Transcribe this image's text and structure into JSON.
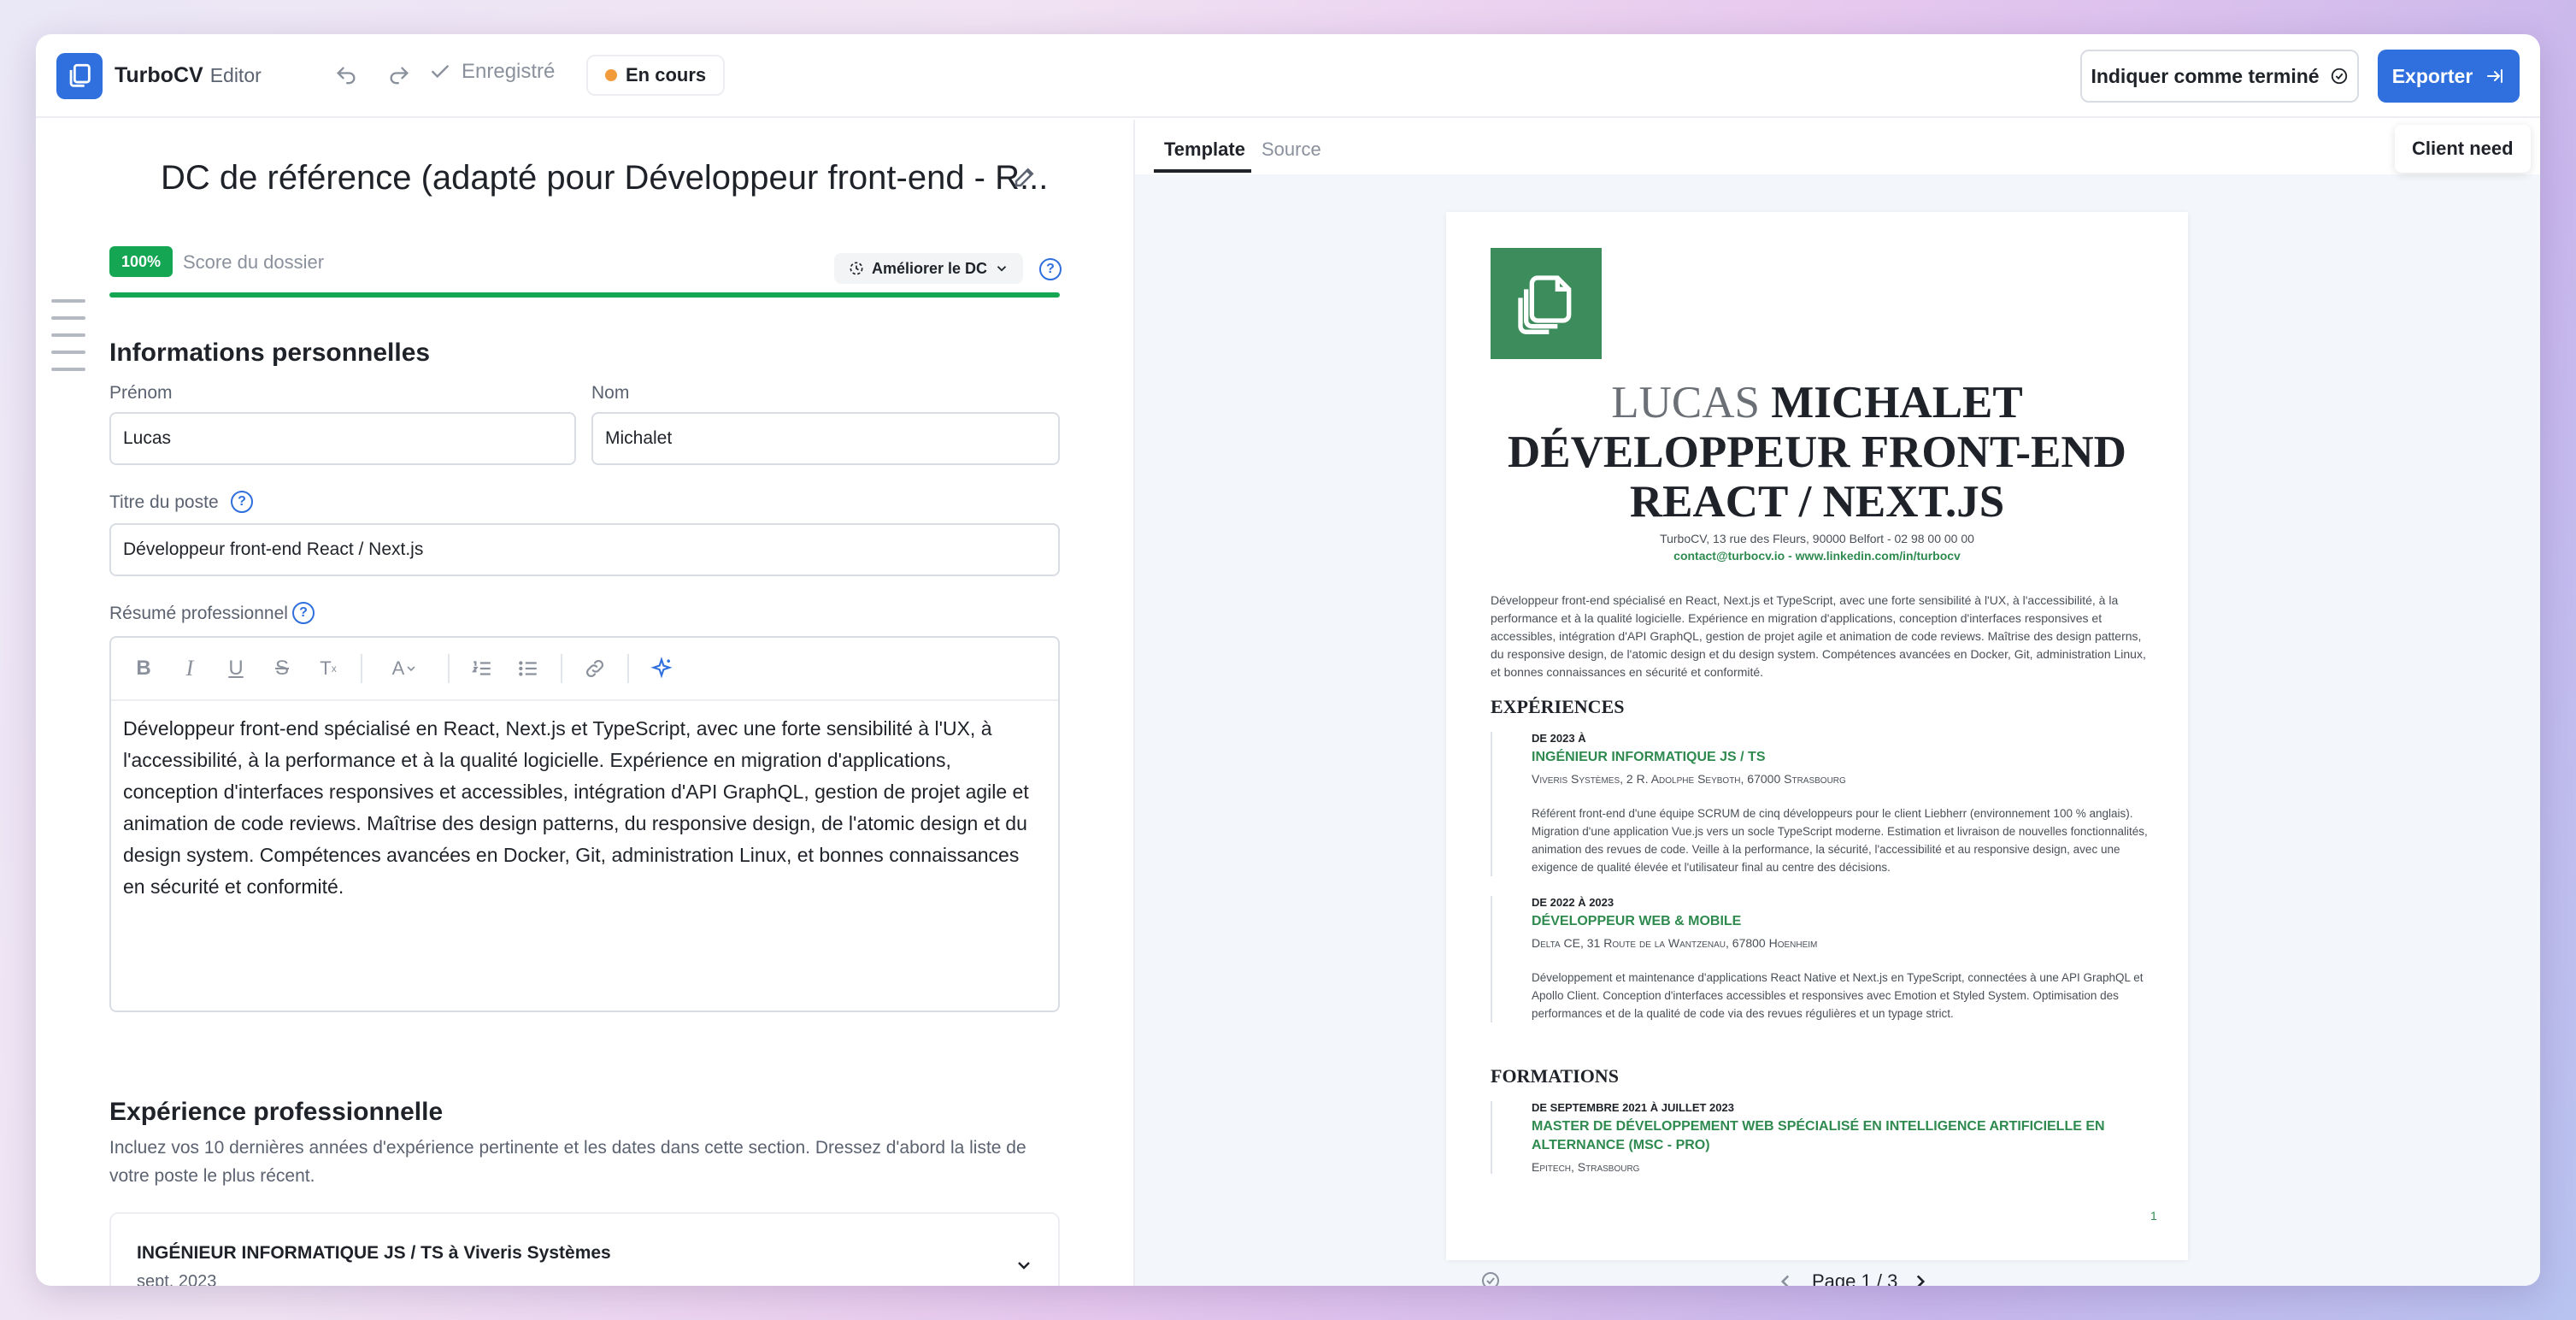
{
  "app": {
    "brand": "TurboCV",
    "mode": "Editor"
  },
  "topbar": {
    "saved_label": "Enregistré",
    "status_label": "En cours",
    "mark_done_label": "Indiquer comme terminé",
    "export_label": "Exporter"
  },
  "document": {
    "title": "DC de référence (adapté pour Développeur front-end - R...",
    "score_value": "100%",
    "score_label": "Score du dossier",
    "progress": 1.0,
    "improve_label": "Améliorer le DC"
  },
  "personal": {
    "section_title": "Informations personnelles",
    "first_name_label": "Prénom",
    "first_name_value": "Lucas",
    "last_name_label": "Nom",
    "last_name_value": "Michalet",
    "job_title_label": "Titre du poste",
    "job_title_value": "Développeur front-end React / Next.js",
    "summary_label": "Résumé professionnel",
    "summary_value": "Développeur front-end spécialisé en React, Next.js et TypeScript, avec une forte sensibilité à l'UX, à l'accessibilité, à la performance et à la qualité logicielle. Expérience en migration d'applications, conception d'interfaces responsives et accessibles, intégration d'API GraphQL, gestion de projet agile et animation de code reviews. Maîtrise des design patterns, du responsive design, de l'atomic design et du design system. Compétences avancées en Docker, Git, administration Linux, et bonnes connaissances en sécurité et conformité."
  },
  "experience": {
    "section_title": "Expérience professionnelle",
    "help_text": "Incluez vos 10 dernières années d'expérience pertinente et les dates dans cette section. Dressez d'abord la liste de votre poste le plus récent.",
    "items": [
      {
        "title": "INGÉNIEUR INFORMATIQUE JS / TS à Viveris Systèmes",
        "date": "sept. 2023"
      }
    ]
  },
  "preview": {
    "tabs": [
      "Template",
      "Source"
    ],
    "client_need_label": "Client need",
    "page_indicator": "Page 1 / 3",
    "cv": {
      "first_name": "LUCAS",
      "last_name": "MICHALET",
      "headline": "DÉVELOPPEUR FRONT-END REACT / NEXT.JS",
      "address": "TurboCV, 13 rue des Fleurs, 90000 Belfort - 02 98 00 00 00",
      "contact": "contact@turbocv.io - www.linkedin.com/in/turbocv",
      "summary": "Développeur front-end spécialisé en React, Next.js et TypeScript, avec une forte sensibilité à l'UX, à l'accessibilité, à la performance et à la qualité logicielle. Expérience en migration d'applications, conception d'interfaces responsives et accessibles, intégration d'API GraphQL, gestion de projet agile et animation de code reviews. Maîtrise des design patterns, du responsive design, de l'atomic design et du design system. Compétences avancées en Docker, Git, administration Linux, et bonnes connaissances en sécurité et conformité.",
      "experiences_title": "EXPÉRIENCES",
      "experiences": [
        {
          "date": "DE 2023 À",
          "role": "INGÉNIEUR INFORMATIQUE JS / TS",
          "org": "Viveris Systèmes, 2 R. Adolphe Seyboth, 67000 Strasbourg",
          "desc": "Référent front-end d'une équipe SCRUM de cinq développeurs pour le client Liebherr (environnement 100 % anglais). Migration d'une application Vue.js vers un socle TypeScript moderne. Estimation et livraison de nouvelles fonctionnalités, animation des revues de code. Veille à la performance, la sécurité, l'accessibilité et au responsive design, avec une exigence de qualité élevée et l'utilisateur final au centre des décisions."
        },
        {
          "date": "DE 2022 À 2023",
          "role": "DÉVELOPPEUR WEB & MOBILE",
          "org": "Delta CE, 31 Route de la Wantzenau, 67800 Hoenheim",
          "desc": "Développement et maintenance d'applications React Native et Next.js en TypeScript, connectées à une API GraphQL et Apollo Client. Conception d'interfaces accessibles et responsives avec Emotion et Styled System. Optimisation des performances et de la qualité de code via des revues régulières et un typage strict."
        }
      ],
      "formations_title": "FORMATIONS",
      "formations": [
        {
          "date": "DE SEPTEMBRE 2021 À JUILLET 2023",
          "role": "MASTER DE DÉVELOPPEMENT WEB SPÉCIALISÉ EN INTELLIGENCE ARTIFICIELLE EN ALTERNANCE (MSC - PRO)",
          "org": "Epitech, Strasbourg"
        }
      ],
      "page_number": "1"
    }
  },
  "colors": {
    "accent": "#2f6fde",
    "success": "#15a653",
    "cv_green": "#2e8a4f",
    "status_orange": "#f29b3a"
  }
}
